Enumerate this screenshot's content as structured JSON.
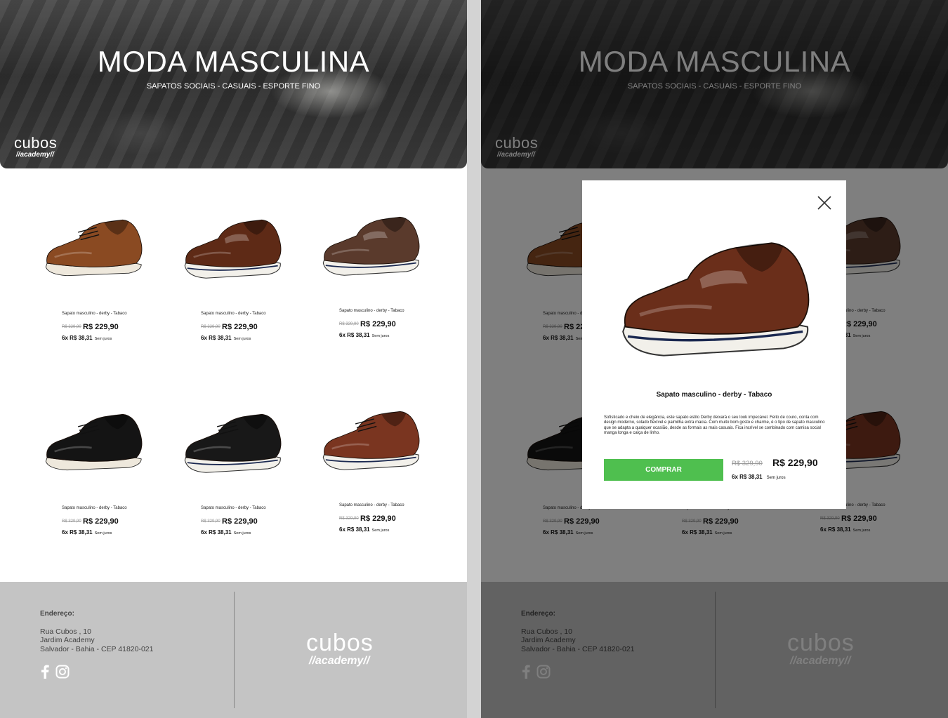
{
  "hero": {
    "title": "MODA MASCULINA",
    "subtitle": "SAPATOS SOCIAIS - CASUAIS - ESPORTE FINO",
    "logo_word": "cubos",
    "logo_sub": "//academy//"
  },
  "products": [
    {
      "name": "Sapato masculino - derby - Tabaco",
      "old_price": "R$ 329,90",
      "price": "R$ 229,90",
      "installments": "6x  R$ 38,31",
      "interest": "Sem juros",
      "color": "#8a4a22"
    },
    {
      "name": "Sapato masculino - derby - Tabaco",
      "old_price": "R$ 329,90",
      "price": "R$ 229,90",
      "installments": "6x  R$ 38,31",
      "interest": "Sem juros",
      "color": "#5e2a16"
    },
    {
      "name": "Sapato masculino - derby - Tabaco",
      "old_price": "R$ 329,90",
      "price": "R$ 229,90",
      "installments": "6x  R$ 38,31",
      "interest": "Sem juros",
      "color": "#5a3a2c"
    },
    {
      "name": "Sapato masculino - derby - Tabaco",
      "old_price": "R$ 329,90",
      "price": "R$ 229,90",
      "installments": "6x  R$ 38,31",
      "interest": "Sem juros",
      "color": "#141414"
    },
    {
      "name": "Sapato masculino - derby - Tabaco",
      "old_price": "R$ 329,90",
      "price": "R$ 229,90",
      "installments": "6x  R$ 38,31",
      "interest": "Sem juros",
      "color": "#181818"
    },
    {
      "name": "Sapato masculino - derby - Tabaco",
      "old_price": "R$ 329,90",
      "price": "R$ 229,90",
      "installments": "6x  R$ 38,31",
      "interest": "Sem juros",
      "color": "#7a3520"
    }
  ],
  "footer": {
    "address_label": "Endereço:",
    "line1": "Rua Cubos ,  10",
    "line2": "Jardim Academy",
    "line3": "Salvador - Bahia - CEP 41820-021",
    "logo_word": "cubos",
    "logo_sub": "//academy//"
  },
  "modal": {
    "title": "Sapato masculino - derby - Tabaco",
    "description": "Sofisticado e cheio de elegância, este sapato estilo Derby deixará o seu look impecável. Feito de couro, conta com design moderno, solado flexível e palmilha extra macia. Com muito bom gosto e charme, é o tipo de sapato masculino que se adapta a qualquer ocasião, desde as formais as mais casuais. Fica incrível se combinado com camisa social manga longa e calça de linho.",
    "button": "COMPRAR",
    "old_price": "R$ 329,90",
    "price": "R$ 229,90",
    "installments": "6x  R$ 38,31",
    "interest": "Sem juros",
    "color": "#6a2e1a"
  },
  "colors": {
    "buy_button": "#4fbf4f",
    "footer_bg": "#c4c4c4",
    "overlay": "rgba(0,0,0,0.5)"
  },
  "icons": [
    "facebook-icon",
    "instagram-icon",
    "close-icon"
  ]
}
